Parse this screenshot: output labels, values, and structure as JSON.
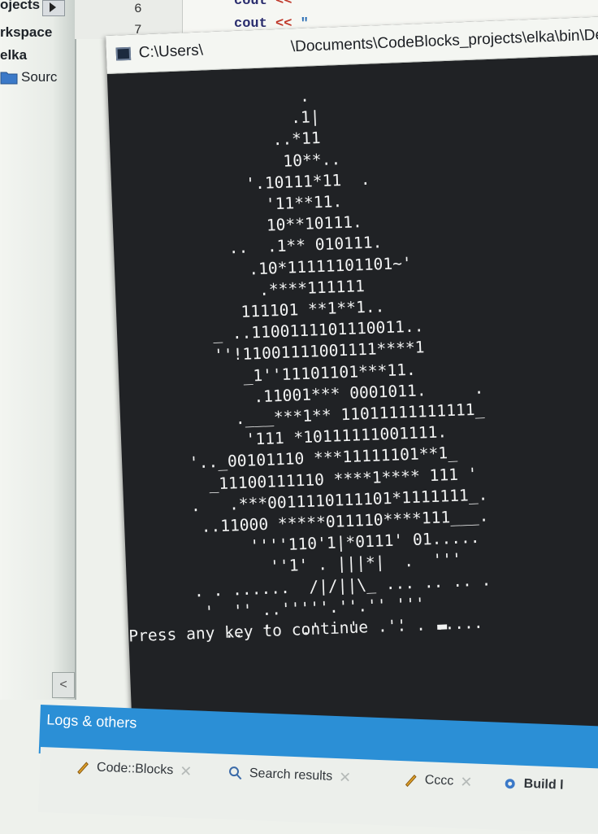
{
  "sidebar": {
    "items": [
      {
        "label": "ojects"
      },
      {
        "label": "rkspace"
      },
      {
        "label": "elka"
      },
      {
        "label": "Sourc"
      }
    ],
    "scroll_left": "<"
  },
  "editor": {
    "line_numbers": [
      "6",
      "7"
    ],
    "lines": [
      {
        "code": "cout",
        "op": "<<",
        "str": ""
      },
      {
        "code": "cout",
        "op": "<<",
        "str": "\""
      }
    ]
  },
  "console": {
    "title_left": "C:\\Users\\",
    "title_right": "\\Documents\\CodeBlocks_projects\\elka\\bin\\Debu",
    "tree_lines": [
      "                    .",
      "                   .1|",
      "                 ..*11",
      "                  10**..",
      "              '.10111*11  .",
      "                '11**11.",
      "                10**10111.",
      "            ..  .1** 010111.",
      "              .10*11111101101~'",
      "               .****111111",
      "             111101 **1**1..",
      "          _ ..1100111101110011..",
      "          ''!11001111001111****1",
      "             _1''11101101***11.",
      "              .11001*** 0001011.     .",
      "            .___***1** 11011111111111_",
      "             '111 *10111111001111.",
      "       '.._00101110 ***11111101**1_",
      "         _11100111110 ****1**** 111 '",
      "       .   .***0011110111101*1111111_.",
      "        ..11000 *****011110****111___.",
      "             ''''110'1|*0111' 01.....",
      "               ''1' . |||*|  .  '''",
      "       . . ......  /|/||\\_ ... .. .. .",
      "        '  '' ..'''''.''.'' '''    ",
      "          ..  '   .'   '   ''   ....."
    ],
    "press_text": "Press any key to continue . . ."
  },
  "logs": {
    "title": "Logs & others",
    "tabs": [
      {
        "label": "Code::Blocks"
      },
      {
        "label": "Search results"
      },
      {
        "label": "Cccc"
      },
      {
        "label": "Build l"
      }
    ]
  },
  "colors": {
    "console_bg": "#202225",
    "console_text": "#f2f3f3",
    "logs_accent": "#2b8fd6"
  }
}
